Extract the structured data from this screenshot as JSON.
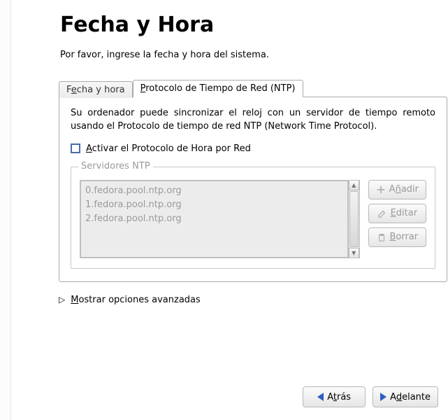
{
  "header": {
    "title": "Fecha y Hora",
    "subtitle": "Por favor, ingrese la fecha y hora del sistema."
  },
  "tabs": {
    "datetime": {
      "pre": "F",
      "u": "e",
      "post": "cha y hora"
    },
    "ntp": {
      "pre": "",
      "u": "P",
      "post": "rotocolo de Tiempo de Red (NTP)"
    }
  },
  "pane": {
    "description": "Su ordenador puede sincronizar el reloj con un servidor de tiempo remoto usando el Protocolo de tiempo de red NTP (Network Time Protocol).",
    "checkbox": {
      "pre": "",
      "u": "A",
      "post": "ctivar el Protocolo de Hora por Red"
    },
    "fieldset_legend": "Servidores NTP",
    "servers": [
      "0.fedora.pool.ntp.org",
      "1.fedora.pool.ntp.org",
      "2.fedora.pool.ntp.org"
    ],
    "buttons": {
      "add": {
        "pre": "A",
        "u": "ñ",
        "post": "adir"
      },
      "edit": {
        "pre": "",
        "u": "E",
        "post": "ditar"
      },
      "delete": {
        "pre": "",
        "u": "B",
        "post": "orrar"
      }
    }
  },
  "expander": {
    "pre": "",
    "u": "M",
    "post": "ostrar opciones avanzadas"
  },
  "footer": {
    "back": {
      "pre": "A",
      "u": "t",
      "post": "rás"
    },
    "forward": {
      "pre": "A",
      "u": "d",
      "post": "elante"
    }
  }
}
